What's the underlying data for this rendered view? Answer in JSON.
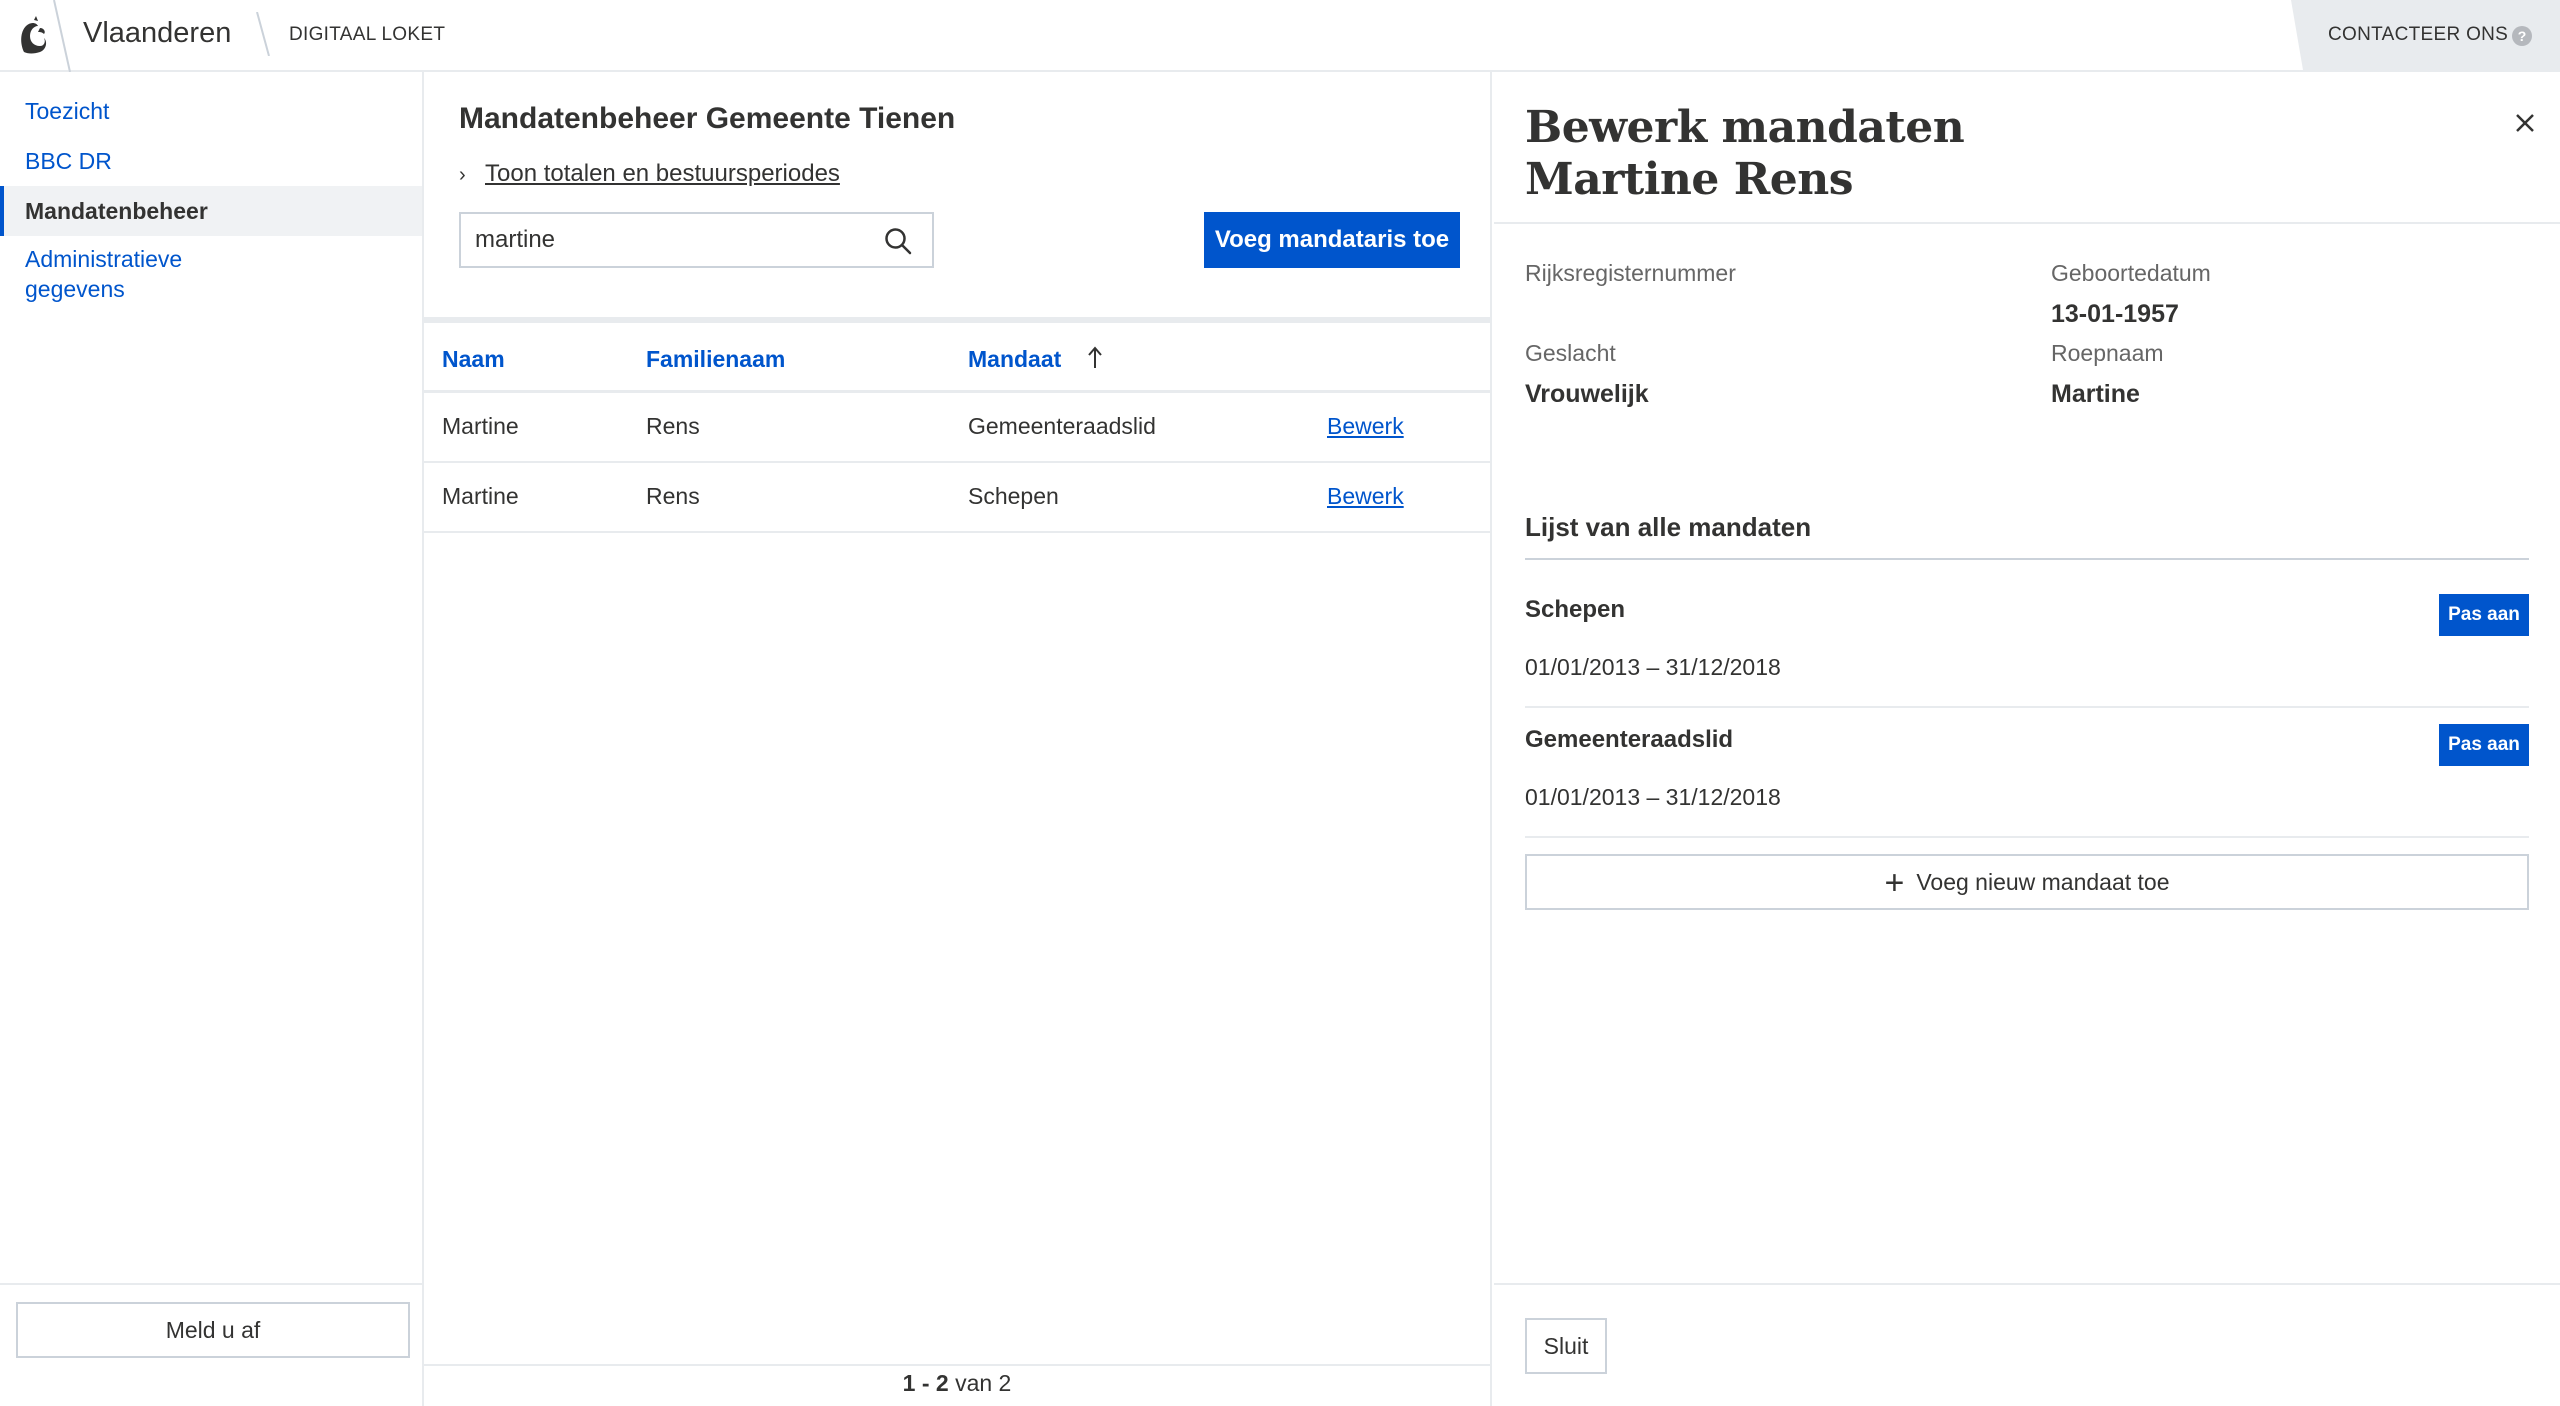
{
  "header": {
    "brand": "Vlaanderen",
    "product": "DIGITAAL LOKET",
    "contact": "CONTACTEER ONS",
    "help_symbol": "?"
  },
  "sidebar": {
    "items": [
      {
        "label": "Toezicht"
      },
      {
        "label": "BBC DR"
      },
      {
        "label": "Mandatenbeheer"
      },
      {
        "label": "Administratieve gegevens"
      }
    ],
    "logout": "Meld u af"
  },
  "main": {
    "title": "Mandatenbeheer Gemeente Tienen",
    "toggle_label": "Toon totalen en bestuursperiodes",
    "search": {
      "value": "martine",
      "placeholder": ""
    },
    "add_button": "Voeg mandataris toe",
    "table": {
      "headers": [
        "Naam",
        "Familienaam",
        "Mandaat"
      ],
      "sort_column": "Mandaat",
      "rows": [
        {
          "naam": "Martine",
          "familienaam": "Rens",
          "mandaat": "Gemeenteraadslid",
          "action": "Bewerk"
        },
        {
          "naam": "Martine",
          "familienaam": "Rens",
          "mandaat": "Schepen",
          "action": "Bewerk"
        }
      ]
    },
    "pager": {
      "range": "1 - 2",
      "suffix": "van 2"
    }
  },
  "panel": {
    "title_line1": "Bewerk mandaten",
    "title_line2": "Martine Rens",
    "fields": {
      "rijksregister_label": "Rijksregisternummer",
      "rijksregister_value": "",
      "geboortedatum_label": "Geboortedatum",
      "geboortedatum_value": "13-01-1957",
      "geslacht_label": "Geslacht",
      "geslacht_value": "Vrouwelijk",
      "roepnaam_label": "Roepnaam",
      "roepnaam_value": "Martine"
    },
    "mandates_title": "Lijst van alle mandaten",
    "mandates": [
      {
        "name": "Schepen",
        "period": "01/01/2013 – 31/12/2018",
        "action": "Pas aan"
      },
      {
        "name": "Gemeenteraadslid",
        "period": "01/01/2013 – 31/12/2018",
        "action": "Pas aan"
      }
    ],
    "add_mandate": "Voeg nieuw mandaat toe",
    "close_button": "Sluit"
  },
  "colors": {
    "accent": "#0055cc",
    "text": "#333332",
    "border": "#e8ebee"
  }
}
